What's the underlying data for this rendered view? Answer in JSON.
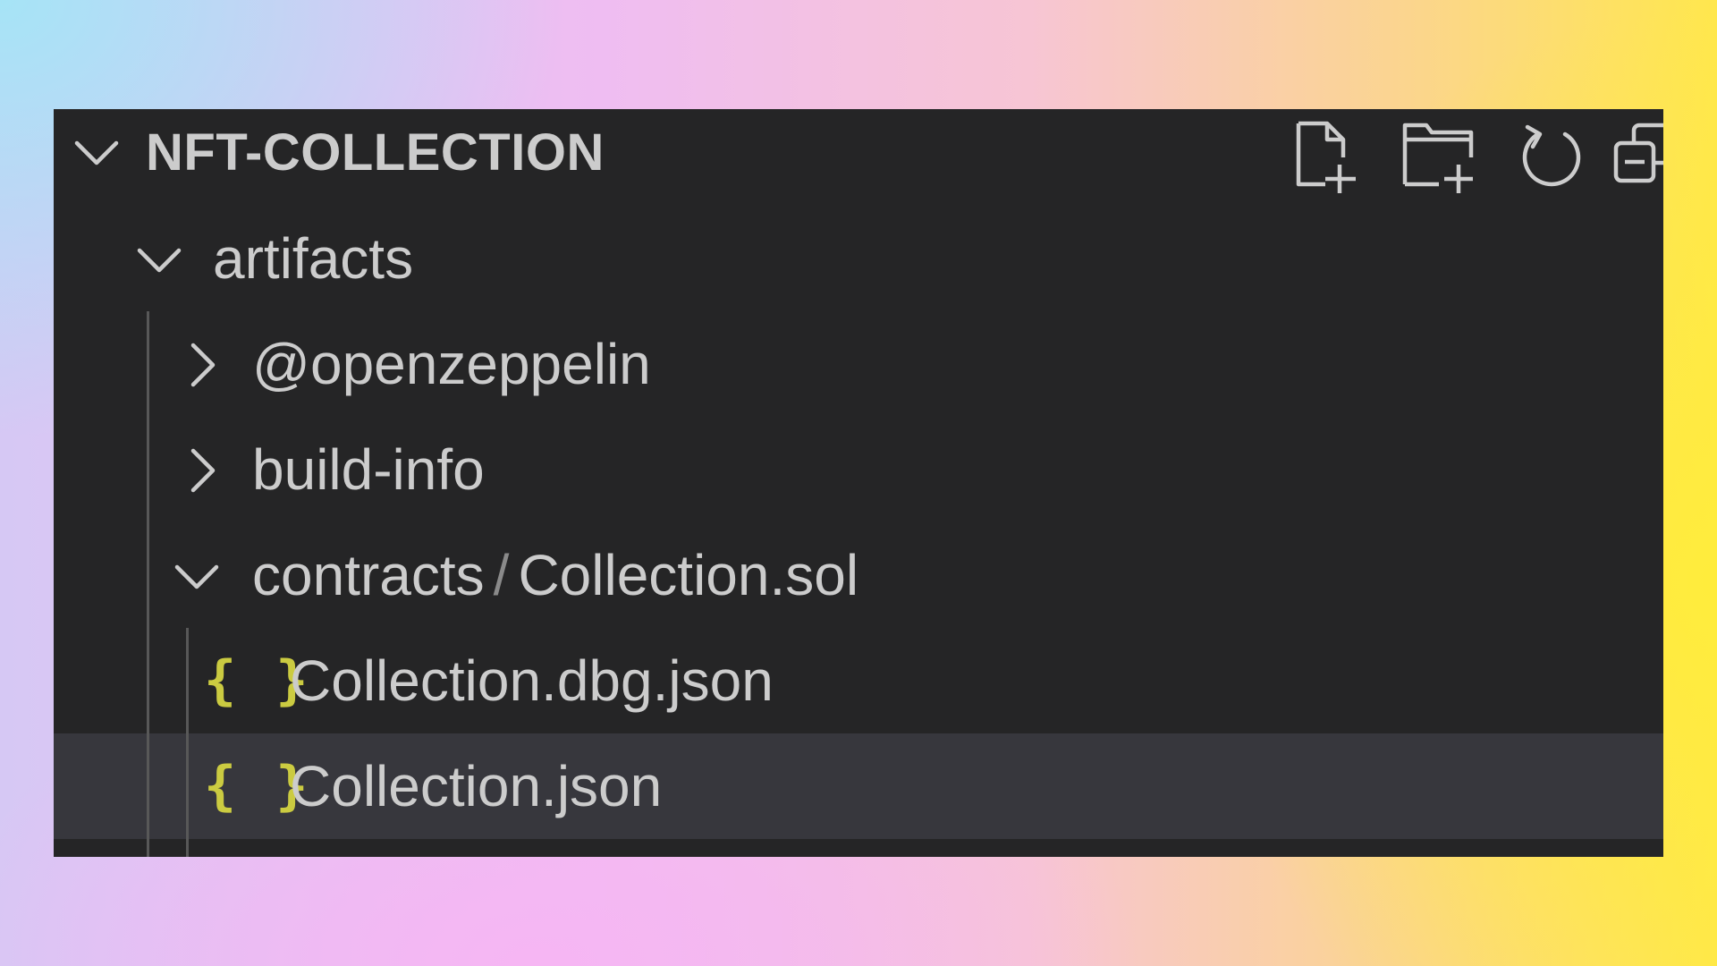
{
  "explorer": {
    "title": "NFT-COLLECTION",
    "actions": [
      {
        "name": "new-file-button",
        "icon": "new-file-icon"
      },
      {
        "name": "new-folder-button",
        "icon": "new-folder-icon"
      },
      {
        "name": "refresh-button",
        "icon": "refresh-icon"
      },
      {
        "name": "collapse-all-button",
        "icon": "collapse-all-icon"
      }
    ]
  },
  "tree": {
    "artifacts": "artifacts",
    "openzeppelin": "@openzeppelin",
    "build_info": "build-info",
    "contracts": "contracts",
    "separator": "/",
    "collection_sol": "Collection.sol",
    "dbg_json": "Collection.dbg.json",
    "collection_json": "Collection.json",
    "json_icon_glyph": "{ }",
    "selected_item": "Collection.json"
  },
  "colors": {
    "panel_bg": "#252526",
    "selected_row": "#37373d",
    "text": "#cccccc",
    "json_icon": "#cbcb41"
  }
}
